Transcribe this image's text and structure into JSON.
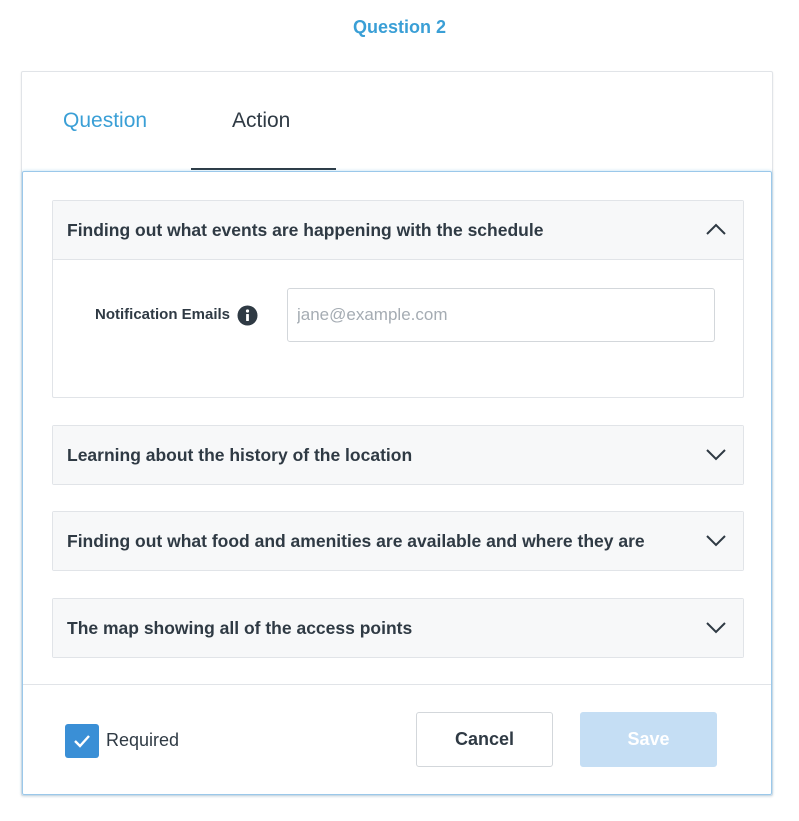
{
  "page": {
    "title": "Question 2"
  },
  "tabs": [
    {
      "label": "Question",
      "active_color": "#3a9fd6"
    },
    {
      "label": "Action",
      "selected": true
    }
  ],
  "accordions": [
    {
      "title": "Finding out what events are happening with the schedule",
      "expanded": true,
      "field": {
        "label": "Notification Emails",
        "icon": "info-icon",
        "value": "",
        "placeholder": "jane@example.com"
      }
    },
    {
      "title": "Learning about the history of the location",
      "expanded": false
    },
    {
      "title": "Finding out what food and amenities are available and where they are",
      "expanded": false
    },
    {
      "title": "The map showing all of the access points",
      "expanded": false
    }
  ],
  "footer": {
    "required_label": "Required",
    "required_checked": true,
    "cancel_label": "Cancel",
    "save_label": "Save",
    "save_disabled": true
  },
  "colors": {
    "accent": "#3a9fd6",
    "checkbox": "#3a8fd6",
    "save_disabled": "#c5def4",
    "text": "#2f3a44"
  }
}
